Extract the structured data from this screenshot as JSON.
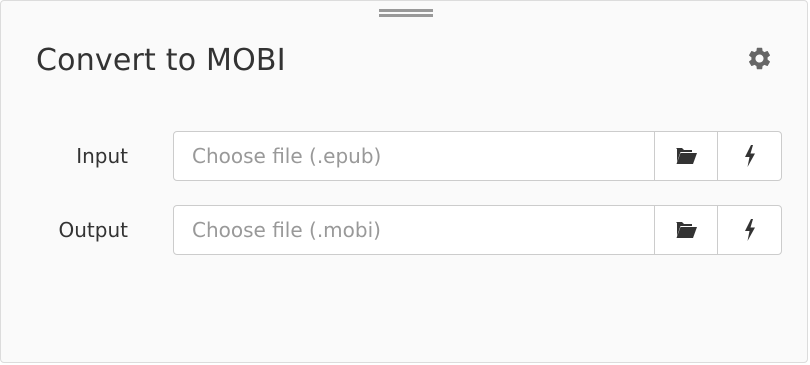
{
  "panel": {
    "title": "Convert to MOBI",
    "icons": {
      "drag_handle": "drag-handle-icon",
      "settings": "gear-icon",
      "browse": "folder-open-icon",
      "quick": "bolt-icon"
    },
    "colors": {
      "background": "#fafafa",
      "text": "#333333",
      "placeholder": "#999999",
      "border": "#cccccc",
      "icon": "#555555"
    }
  },
  "rows": {
    "input": {
      "label": "Input",
      "value": "",
      "placeholder": "Choose file (.epub)"
    },
    "output": {
      "label": "Output",
      "value": "",
      "placeholder": "Choose file (.mobi)"
    }
  }
}
